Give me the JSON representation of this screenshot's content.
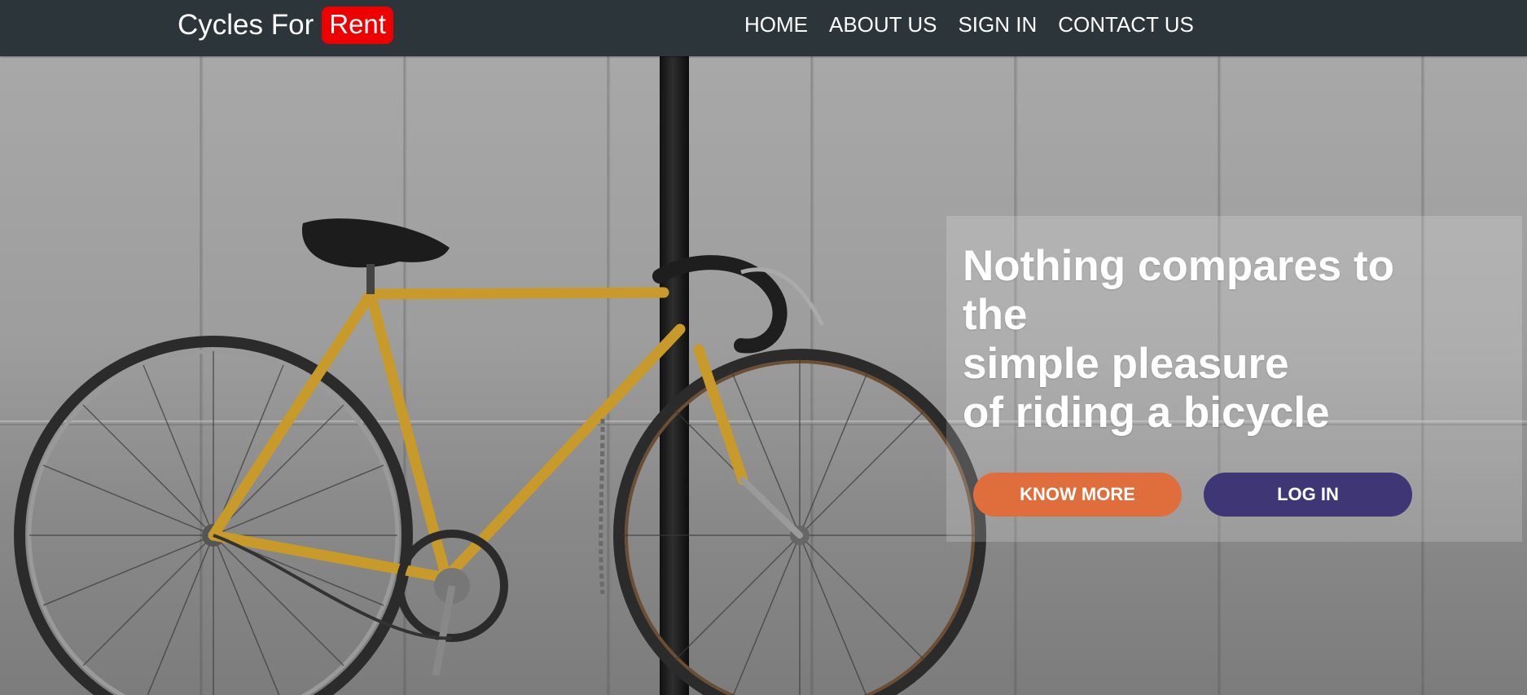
{
  "navbar": {
    "brand_text": "Cycles For",
    "brand_badge": "Rent",
    "links": [
      "HOME",
      "ABOUT US",
      "SIGN IN",
      "CONTACT US"
    ]
  },
  "hero": {
    "headline_lines": [
      "Nothing compares to",
      "the",
      "simple pleasure",
      "of riding a bicycle"
    ],
    "buttons": {
      "know_more": "KNOW MORE",
      "log_in": "LOG IN"
    }
  },
  "colors": {
    "navbar_bg": "#2c3539",
    "brand_badge": "#ee0000",
    "know_more_button": "#df6e3c",
    "log_in_button": "#3f3675"
  }
}
